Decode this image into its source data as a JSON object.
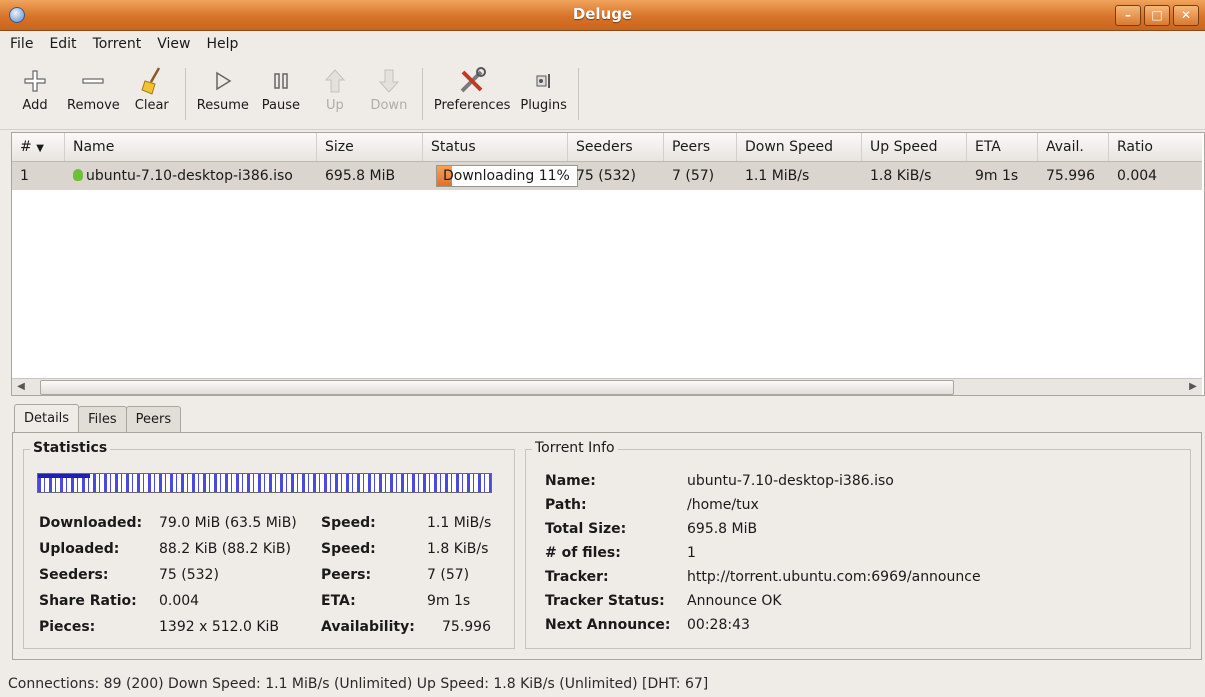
{
  "window": {
    "title": "Deluge"
  },
  "menu": [
    "File",
    "Edit",
    "Torrent",
    "View",
    "Help"
  ],
  "toolbar": {
    "add": "Add",
    "remove": "Remove",
    "clear": "Clear",
    "resume": "Resume",
    "pause": "Pause",
    "up": "Up",
    "down": "Down",
    "preferences": "Preferences",
    "plugins": "Plugins"
  },
  "columns": {
    "num": "#",
    "name": "Name",
    "size": "Size",
    "status": "Status",
    "seeders": "Seeders",
    "peers": "Peers",
    "down_speed": "Down Speed",
    "up_speed": "Up Speed",
    "eta": "ETA",
    "avail": "Avail.",
    "ratio": "Ratio"
  },
  "torrent": {
    "num": "1",
    "name": "ubuntu-7.10-desktop-i386.iso",
    "size": "695.8 MiB",
    "status": "Downloading 11%",
    "progress": 0.11,
    "seeders": "75 (532)",
    "peers": "7 (57)",
    "down_speed": "1.1 MiB/s",
    "up_speed": "1.8 KiB/s",
    "eta": "9m 1s",
    "avail": "75.996",
    "ratio": "0.004"
  },
  "tabs": [
    "Details",
    "Files",
    "Peers"
  ],
  "statistics": {
    "label": "Statistics",
    "downloaded_k": "Downloaded:",
    "downloaded_v": "79.0 MiB (63.5 MiB)",
    "uploaded_k": "Uploaded:",
    "uploaded_v": "88.2 KiB (88.2 KiB)",
    "seeders_k": "Seeders:",
    "seeders_v": "75 (532)",
    "ratio_k": "Share Ratio:",
    "ratio_v": "0.004",
    "pieces_k": "Pieces:",
    "pieces_v": "1392 x 512.0 KiB",
    "dspeed_k": "Speed:",
    "dspeed_v": "1.1 MiB/s",
    "uspeed_k": "Speed:",
    "uspeed_v": "1.8 KiB/s",
    "peers_k": "Peers:",
    "peers_v": "7 (57)",
    "eta_k": "ETA:",
    "eta_v": "9m 1s",
    "avail_k": "Availability:",
    "avail_v": "75.996"
  },
  "torrent_info": {
    "label": "Torrent Info",
    "name_k": "Name:",
    "name_v": "ubuntu-7.10-desktop-i386.iso",
    "path_k": "Path:",
    "path_v": "/home/tux",
    "size_k": "Total Size:",
    "size_v": "695.8 MiB",
    "files_k": "# of files:",
    "files_v": "1",
    "tracker_k": "Tracker:",
    "tracker_v": "http://torrent.ubuntu.com:6969/announce",
    "tstatus_k": "Tracker Status:",
    "tstatus_v": "Announce OK",
    "next_k": "Next Announce:",
    "next_v": "00:28:43"
  },
  "statusbar": "Connections: 89 (200)  Down Speed: 1.1 MiB/s (Unlimited)  Up Speed: 1.8 KiB/s (Unlimited)   [DHT: 67]"
}
